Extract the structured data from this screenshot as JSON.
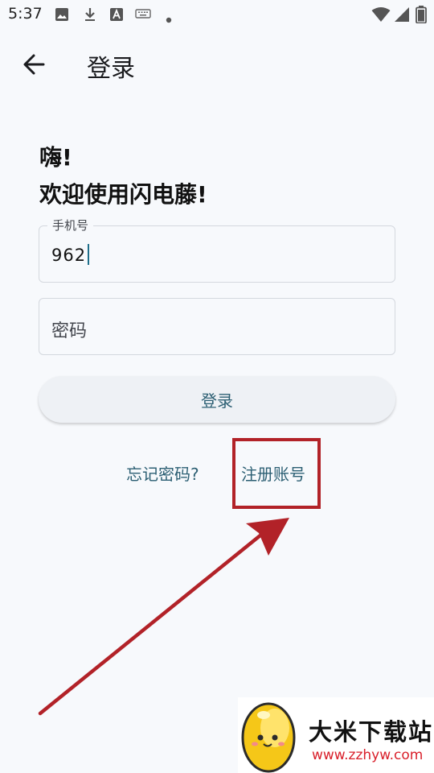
{
  "status_bar": {
    "time": "5:37",
    "icons": [
      "image-icon",
      "download-icon",
      "font-a-icon",
      "keyboard-icon",
      "dot-icon",
      "wifi-icon",
      "signal-icon",
      "battery-icon"
    ]
  },
  "header": {
    "title": "登录",
    "back_icon": "arrow-left-icon"
  },
  "greeting": {
    "line1": "嗨!",
    "line2": "欢迎使用闪电藤!"
  },
  "form": {
    "phone": {
      "label": "手机号",
      "value": "962"
    },
    "password": {
      "placeholder": "密码"
    },
    "login_button": "登录"
  },
  "links": {
    "forgot_password": "忘记密码?",
    "register": "注册账号"
  },
  "annotation": {
    "highlight_color": "#b22228"
  },
  "watermark": {
    "brand": "大米下载站",
    "url": "www.zzhyw.com"
  },
  "colors": {
    "accent": "#2c5f73",
    "background": "#f7f9fc",
    "annotation": "#b22228"
  }
}
